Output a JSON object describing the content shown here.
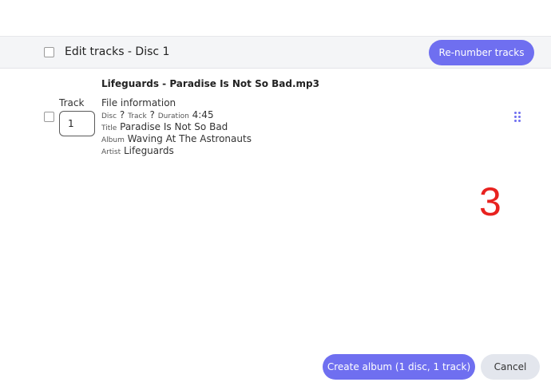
{
  "header": {
    "title": "Edit tracks - Disc 1",
    "renumber_label": "Re-number tracks"
  },
  "track_row": {
    "file_name": "Lifeguards - Paradise Is Not So Bad.mp3",
    "track_label": "Track",
    "track_value": "1",
    "info_heading": "File information",
    "disc_key": "Disc",
    "disc_value": "?",
    "track_key": "Track",
    "track_num_value": "?",
    "duration_key": "Duration",
    "duration_value": "4:45",
    "title_key": "Title",
    "title_value": "Paradise Is Not So Bad",
    "album_key": "Album",
    "album_value": "Waving At The Astronauts",
    "artist_key": "Artist",
    "artist_value": "Lifeguards",
    "drag_icon": "drag-handle-icon"
  },
  "overlay": {
    "number": "3",
    "color": "#e8221f"
  },
  "footer": {
    "create_label": "Create album (1 disc, 1 track)",
    "cancel_label": "Cancel"
  },
  "colors": {
    "accent": "#6f6ff0",
    "header_bg": "#f4f5f7",
    "cancel_bg": "#e3e6ed"
  }
}
